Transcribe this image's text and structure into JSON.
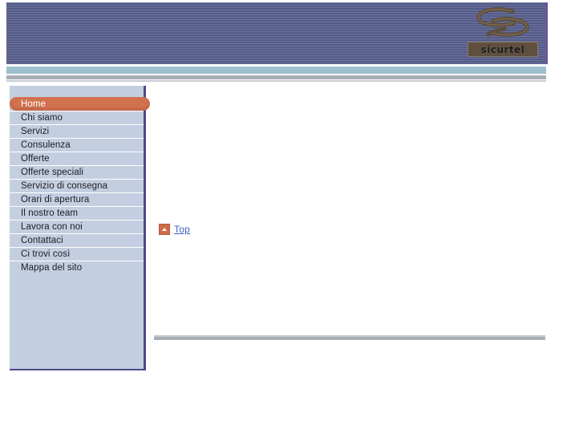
{
  "header": {
    "logo_wordmark": "sicurtel",
    "logo_mark_name": "spiral-swirl-logo",
    "banner_color": "#5a6291",
    "accent_color": "#d2714e"
  },
  "sidebar": {
    "items": [
      {
        "label": "Home",
        "active": true
      },
      {
        "label": "Chi siamo",
        "active": false
      },
      {
        "label": "Servizi",
        "active": false
      },
      {
        "label": "Consulenza",
        "active": false
      },
      {
        "label": "Offerte",
        "active": false
      },
      {
        "label": "Offerte speciali",
        "active": false
      },
      {
        "label": "Servizio di consegna",
        "active": false
      },
      {
        "label": "Orari di apertura",
        "active": false
      },
      {
        "label": "Il nostro team",
        "active": false
      },
      {
        "label": "Lavora con noi",
        "active": false
      },
      {
        "label": "Contattaci",
        "active": false
      },
      {
        "label": "Ci trovi così",
        "active": false
      },
      {
        "label": "Mappa del sito",
        "active": false
      }
    ]
  },
  "content": {
    "top_link_label": "Top",
    "top_link_icon": "up-arrow-icon"
  }
}
